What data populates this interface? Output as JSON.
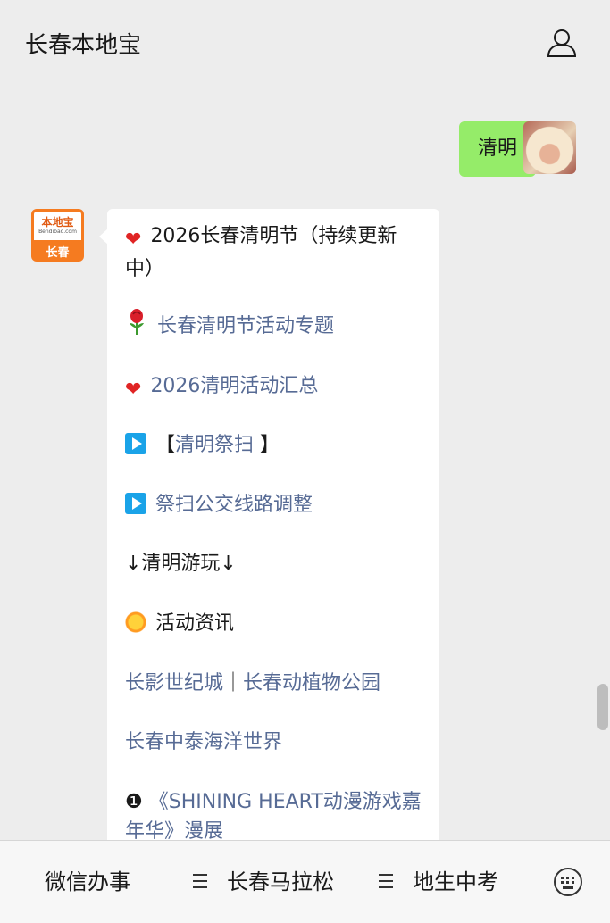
{
  "header": {
    "title": "长春本地宝"
  },
  "chat": {
    "user_message": "清明",
    "bot_reply": {
      "title": "2026长春清明节（持续更新中）",
      "lines": [
        {
          "text": "长春清明节活动专题",
          "emoji": "rose-icon",
          "link": true
        },
        {
          "text": "2026清明活动汇总",
          "emoji": "heart-icon",
          "link": true
        },
        {
          "bracket_open": "【",
          "text": "清明祭扫",
          "bracket_close": " 】",
          "emoji": "play-icon",
          "link": true
        },
        {
          "text": "祭扫公交线路调整",
          "emoji": "play-icon",
          "link": true
        },
        {
          "text": "↓清明游玩↓",
          "link": false
        },
        {
          "text": "活动资讯",
          "emoji": "sun-icon",
          "link": false
        },
        {
          "text_a": "长影世纪城",
          "separator": "｜",
          "text_b": "长春动植物公园",
          "link": true
        },
        {
          "text": "长春中泰海洋世界",
          "link": true
        },
        {
          "number": "❶",
          "text": "《SHINING HEART动漫游戏嘉年华》漫展",
          "link": true
        }
      ]
    },
    "bot_avatar": {
      "logo": "本地宝",
      "sub": "Bendibao.com",
      "city": "长春"
    }
  },
  "bottom_menu": {
    "items": [
      "微信办事",
      "长春马拉松",
      "地生中考"
    ]
  },
  "colors": {
    "user_bubble": "#95ec69",
    "link": "#576b95",
    "background": "#ededed"
  }
}
